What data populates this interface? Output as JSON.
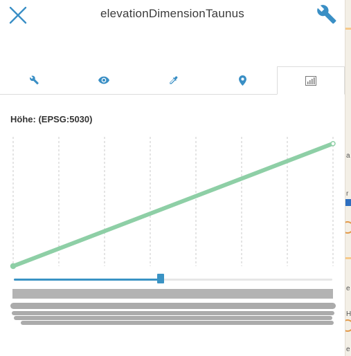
{
  "header": {
    "title": "elevationDimensionTaunus",
    "close_icon": "close-icon",
    "tool_icon": "wrench-icon",
    "accent": "#3a8fc5"
  },
  "tabs": [
    {
      "icon": "wrench-icon",
      "active": false
    },
    {
      "icon": "eye-icon",
      "active": false
    },
    {
      "icon": "eyedropper-icon",
      "active": false
    },
    {
      "icon": "map-pin-icon",
      "active": false
    },
    {
      "icon": "elevation-chart-icon",
      "active": true
    }
  ],
  "elevation": {
    "label": "Höhe: (EPSG:5030)",
    "line_color": "#8ecfa6"
  },
  "chart_data": {
    "type": "line",
    "title": "",
    "xlabel": "",
    "ylabel": "",
    "grid": true,
    "x": [
      0,
      1
    ],
    "y": [
      0,
      1
    ],
    "xlim": [
      0,
      1
    ],
    "ylim": [
      0,
      1.1
    ],
    "series": [
      {
        "values": [
          0,
          1
        ]
      }
    ]
  },
  "slider": {
    "value": 0.46,
    "color": "#3a93c4"
  }
}
